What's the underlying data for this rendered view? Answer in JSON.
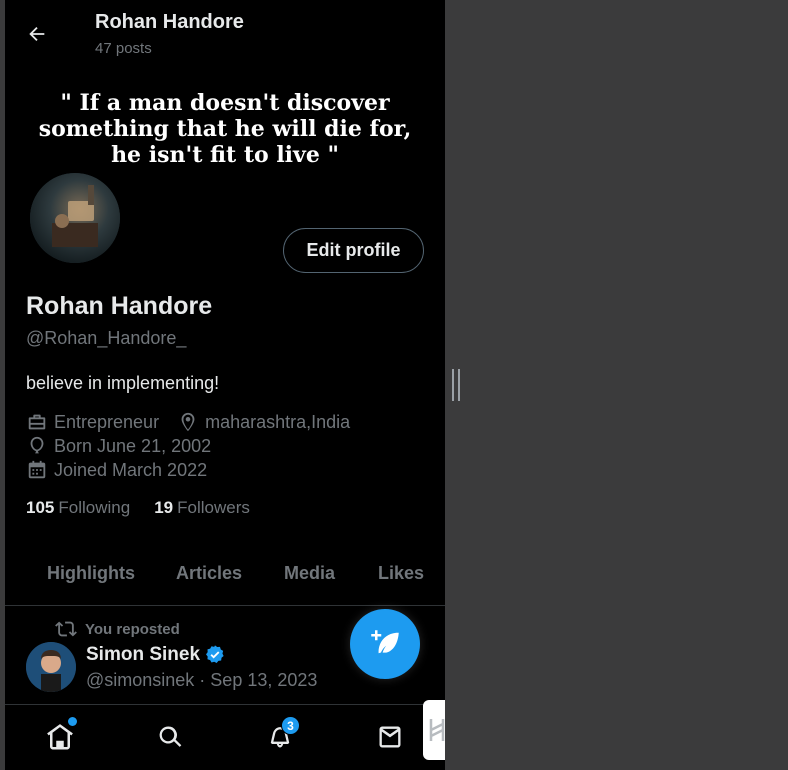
{
  "header": {
    "name": "Rohan Handore",
    "posts_count": "47 posts"
  },
  "banner": {
    "quote_lines": [
      "\" If a man doesn't discover",
      "something that he will die for,",
      "he isn't fit to live \""
    ]
  },
  "profile": {
    "edit_label": "Edit profile",
    "display_name": "Rohan Handore",
    "handle": "@Rohan_Handore_",
    "bio": "believe in implementing!",
    "profession": "Entrepreneur",
    "location": "maharashtra,India",
    "born": "Born June 21, 2002",
    "joined": "Joined March 2022",
    "following_count": "105",
    "following_label": "Following",
    "followers_count": "19",
    "followers_label": "Followers"
  },
  "tabs": [
    {
      "label": "Highlights"
    },
    {
      "label": "Articles"
    },
    {
      "label": "Media"
    },
    {
      "label": "Likes"
    }
  ],
  "post": {
    "repost_text": "You reposted",
    "author": "Simon Sinek",
    "meta": "@simonsinek · Sep 13, 2023"
  },
  "nav": {
    "notifications_badge": "3"
  },
  "colors": {
    "accent": "#1d9bf0",
    "background": "#000000",
    "muted": "#71767b",
    "text": "#e7e9ea"
  },
  "icons": [
    "back-arrow-icon",
    "briefcase-icon",
    "location-pin-icon",
    "balloon-icon",
    "calendar-icon",
    "repost-icon",
    "verified-badge-icon",
    "compose-post-icon",
    "home-icon",
    "search-icon",
    "bell-icon",
    "mail-icon"
  ]
}
